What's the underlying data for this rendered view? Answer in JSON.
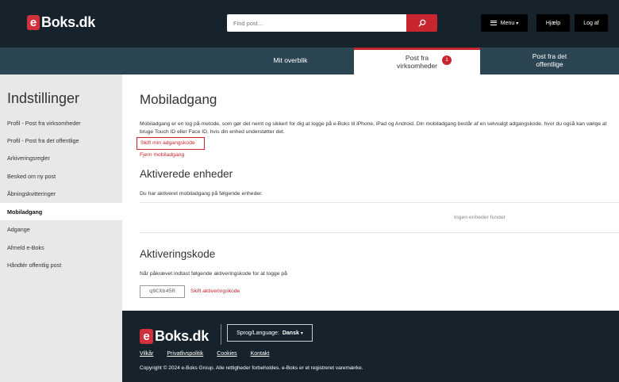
{
  "header": {
    "logo_e": "e",
    "logo_text": "Boks.dk",
    "search_placeholder": "Find post...",
    "menu_label": "Menu",
    "menu_caret": "▾",
    "help_label": "Hjælp",
    "logout_label": "Log af"
  },
  "tabs": {
    "overview": "Mit overblik",
    "business": "Post fra virksomheder",
    "business_badge": "1",
    "public": "Post fra det offentlige"
  },
  "sidebar": {
    "title": "Indstillinger",
    "items": [
      "Profil - Post fra virksomheder",
      "Profil - Post fra det offentlige",
      "Arkiveringsregler",
      "Besked om ny post",
      "Åbningskvitteringer",
      "Mobiladgang",
      "Adgange",
      "Afmeld e-Boks",
      "Håndtér offentlig post"
    ],
    "active_index": 5
  },
  "main": {
    "title": "Mobiladgang",
    "description": "Mobiladgang er en log på-metode, som gør det nemt og sikkert for dig at logge på e-Boks til iPhone, iPad og Android. Din mobiladgang består af en selvvalgt adgangskode, hvor du også kan vælge at bruge Touch ID eller Face ID, hvis din enhed understøtter det.",
    "change_code_link": "Skift min adgangskode",
    "remove_link": "Fjern mobiladgang",
    "devices_title": "Aktiverede enheder",
    "devices_text": "Du har aktiveret mobiladgang på følgende enheder.",
    "no_devices": "Ingen enheder fundet",
    "activation_title": "Aktiveringskode",
    "activation_text": "Når påkrævet indtast følgende aktiveringskode for at logge på",
    "activation_code": "q9CXb45R",
    "change_activation_link": "Skift aktiveringskode"
  },
  "footer": {
    "logo_e": "e",
    "logo_text": "Boks.dk",
    "lang_label": "Sprog/Language:",
    "lang_value": "Dansk",
    "lang_caret": "▾",
    "links": [
      "Vilkår",
      "Privatlivspolitik",
      "Cookies",
      "Kontakt"
    ],
    "copyright": "Copyright © 2024 e-Boks Group. Alle rettigheder forbeholdes. e-Boks er et registreret varemærke."
  },
  "colors": {
    "header_bg": "#16232c",
    "tabbar_bg": "#2c4553",
    "accent": "#c8262f",
    "sidebar_bg": "#e8e8e8"
  }
}
